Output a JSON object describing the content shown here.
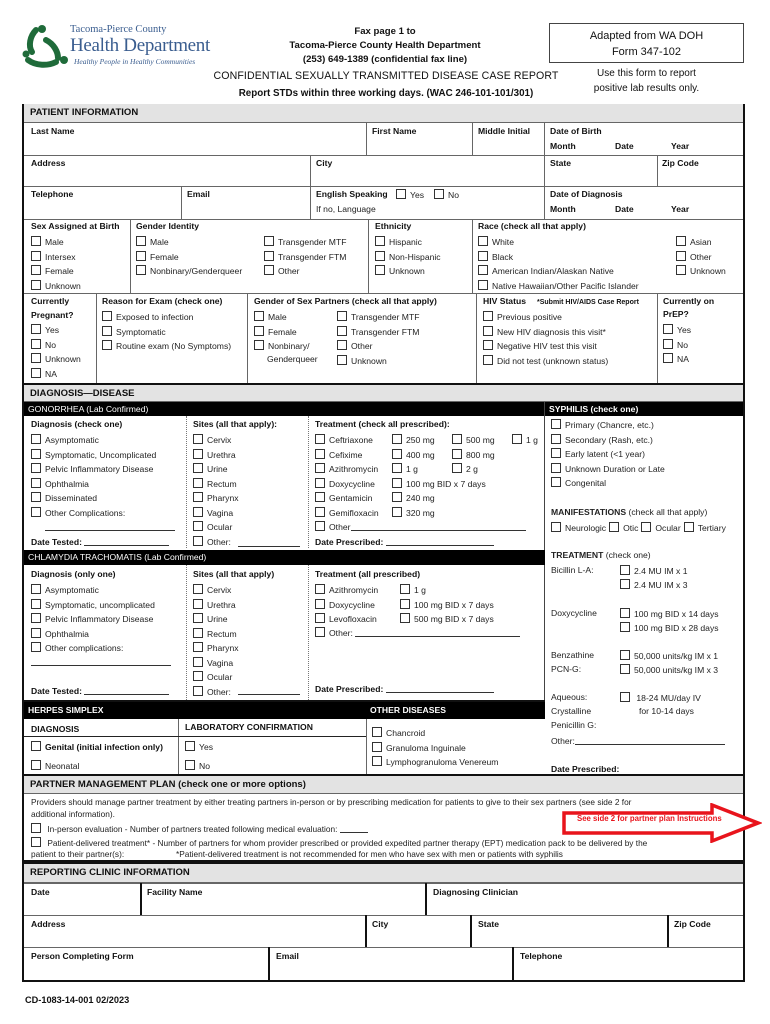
{
  "header": {
    "logo": {
      "org_top": "Tacoma-Pierce County",
      "org_main": "Health Department",
      "tagline": "Healthy People in Healthy Communities",
      "brand_color": "#1f6b3a",
      "text_color": "#3a5d8f"
    },
    "fax_line1": "Fax page 1 to",
    "fax_line2": "Tacoma-Pierce County Health Department",
    "fax_line3": "(253) 649-1389 (confidential fax line)",
    "title": "CONFIDENTIAL SEXUALLY TRANSMITTED DISEASE CASE REPORT",
    "subtitle": "Report STDs within three working days. (WAC 246-101-101/301)",
    "adapted_line1": "Adapted from WA DOH",
    "adapted_line2": "Form 347-102",
    "note_line1": "Use this form to report",
    "note_line2": "positive lab results only."
  },
  "patient": {
    "section_title": "PATIENT INFORMATION",
    "last_name": "Last Name",
    "first_name": "First Name",
    "middle_initial": "Middle Initial",
    "dob": "Date of Birth",
    "month": "Month",
    "date": "Date",
    "year": "Year",
    "address": "Address",
    "city": "City",
    "state": "State",
    "zip": "Zip Code",
    "telephone": "Telephone",
    "email": "Email",
    "english_speaking": "English Speaking",
    "yes": "Yes",
    "no": "No",
    "if_no_language": "If no, Language",
    "date_of_diagnosis": "Date of Diagnosis",
    "sex_at_birth": {
      "label": "Sex Assigned at Birth",
      "options": [
        "Male",
        "Intersex",
        "Female",
        "Unknown"
      ]
    },
    "gender_identity": {
      "label": "Gender Identity",
      "col1": [
        "Male",
        "Female",
        "Nonbinary/Genderqueer"
      ],
      "col2": [
        "Transgender MTF",
        "Transgender FTM",
        "Other"
      ]
    },
    "ethnicity": {
      "label": "Ethnicity",
      "options": [
        "Hispanic",
        "Non-Hispanic",
        "Unknown"
      ]
    },
    "race": {
      "label": "Race (check all that apply)",
      "col1": [
        "White",
        "Black",
        "American Indian/Alaskan Native",
        "Native Hawaiian/Other Pacific Islander"
      ],
      "col2": [
        "Asian",
        "Other",
        "Unknown"
      ]
    },
    "pregnant": {
      "label1": "Currently",
      "label2": "Pregnant?",
      "options": [
        "Yes",
        "No",
        "Unknown",
        "NA"
      ]
    },
    "reason": {
      "label": "Reason for Exam (check one)",
      "options": [
        "Exposed to infection",
        "Symptomatic",
        "Routine exam (No Symptoms)"
      ]
    },
    "partners_gender": {
      "label": "Gender of Sex Partners (check all that apply)",
      "col1": [
        "Male",
        "Female",
        "Nonbinary/"
      ],
      "col1_extra": "Genderqueer",
      "col2": [
        "Transgender MTF",
        "Transgender FTM",
        "Other",
        "Unknown"
      ]
    },
    "hiv": {
      "label": "HIV Status",
      "note": "*Submit HIV/AIDS Case Report",
      "options": [
        "Previous positive",
        "New HIV diagnosis this visit*",
        "Negative HIV test this visit",
        "Did not test (unknown status)"
      ]
    },
    "prep": {
      "label1": "Currently on",
      "label2": "PrEP?",
      "options": [
        "Yes",
        "No",
        "NA"
      ]
    }
  },
  "diagnosis": {
    "section_title": "DIAGNOSIS—DISEASE",
    "gonorrhea": {
      "title": "GONORRHEA (Lab Confirmed)",
      "dx_label": "Diagnosis (check one)",
      "dx_options": [
        "Asymptomatic",
        "Symptomatic, Uncomplicated",
        "Pelvic Inflammatory Disease",
        "Ophthalmia",
        "Disseminated",
        "Other Complications:"
      ],
      "date_tested": "Date Tested:",
      "sites_label": "Sites (all that apply):",
      "sites": [
        "Cervix",
        "Urethra",
        "Urine",
        "Rectum",
        "Pharynx",
        "Vagina",
        "Ocular",
        "Other:"
      ],
      "tx_label": "Treatment (check all prescribed):",
      "tx_rows": [
        {
          "drug": "Ceftriaxone",
          "doses": [
            "250 mg",
            "500 mg",
            "1 g"
          ]
        },
        {
          "drug": "Cefixime",
          "doses": [
            "400 mg",
            "800 mg"
          ]
        },
        {
          "drug": "Azithromycin",
          "doses": [
            "1 g",
            "2 g"
          ]
        },
        {
          "drug": "Doxycycline",
          "doses": [
            "100 mg BID x 7 days"
          ]
        },
        {
          "drug": "Gentamicin",
          "doses": [
            "240 mg"
          ]
        },
        {
          "drug": "Gemifloxacin",
          "doses": [
            "320 mg"
          ]
        }
      ],
      "tx_other": "Other",
      "date_prescribed": "Date Prescribed:"
    },
    "chlamydia": {
      "title": "CHLAMYDIA TRACHOMATIS (Lab Confirmed)",
      "dx_label": "Diagnosis (only one)",
      "dx_options": [
        "Asymptomatic",
        "Symptomatic, uncomplicated",
        "Pelvic Inflammatory Disease",
        "Ophthalmia",
        "Other complications:"
      ],
      "date_tested": "Date Tested:",
      "sites_label": "Sites (all that apply)",
      "sites": [
        "Cervix",
        "Urethra",
        "Urine",
        "Rectum",
        "Pharynx",
        "Vagina",
        "Ocular",
        "Other:"
      ],
      "tx_label": "Treatment (all prescribed)",
      "tx_rows": [
        {
          "drug": "Azithromycin",
          "doses": [
            "1 g"
          ]
        },
        {
          "drug": "Doxycycline",
          "doses": [
            "100 mg BID x 7 days"
          ]
        },
        {
          "drug": "Levofloxacin",
          "doses": [
            "500 mg BID x 7 days"
          ]
        }
      ],
      "tx_other": "Other:",
      "date_prescribed": "Date Prescribed:"
    },
    "syphilis": {
      "title": "SYPHILIS (check one)",
      "options": [
        "Primary (Chancre, etc.)",
        "Secondary (Rash, etc.)",
        "Early latent (<1 year)",
        "Unknown Duration or Late",
        "Congenital"
      ],
      "manifestations_label": "MANIFESTATIONS",
      "manifestations_note": "(check all that apply)",
      "manifestations": [
        "Neurologic",
        "Otic",
        "Ocular",
        "Tertiary"
      ],
      "treatment_label": "TREATMENT",
      "treatment_note": "(check one)",
      "bicillin": "Bicillin L-A:",
      "bicillin_doses": [
        "2.4 MU IM x 1",
        "2.4 MU IM x 3"
      ],
      "doxy": "Doxycycline",
      "doxy_doses": [
        "100 mg BID x 14 days",
        "100 mg BID x 28 days"
      ],
      "benz1": "Benzathine",
      "benz2": "PCN-G:",
      "benz_doses": [
        "50,000 units/kg IM x 1",
        "50,000 units/kg IM x 3"
      ],
      "aq1": "Aqueous:",
      "aq2": "Crystalline",
      "aq3": "Penicillin G:",
      "aq_dose1": "18-24 MU/day IV",
      "aq_dose2": "for 10-14 days",
      "other": "Other:",
      "date_prescribed": "Date Prescribed:"
    },
    "herpes": {
      "title": "HERPES SIMPLEX",
      "dx_label": "DIAGNOSIS",
      "lab_label": "LABORATORY CONFIRMATION",
      "genital": "Genital (initial infection only)",
      "neonatal": "Neonatal",
      "yes": "Yes",
      "no": "No"
    },
    "other_diseases": {
      "title": "OTHER DISEASES",
      "options": [
        "Chancroid",
        "Granuloma Inguinale",
        "Lymphogranuloma Venereum"
      ]
    }
  },
  "partner": {
    "section_title": "PARTNER MANAGEMENT PLAN (check one or more options)",
    "intro1": "Providers should manage partner treatment by either treating partners in-person or by prescribing medication for patients to give to their sex partners (see side 2 for",
    "intro2": "additional information).",
    "callout": "See side 2 for partner plan Instructions",
    "callout_color": "#e8141c",
    "opt1": "In-person evaluation - Number of partners treated following medical evaluation:",
    "opt2": "Patient-delivered treatment* - Number of partners for whom provider prescribed or provided expedited partner therapy (EPT) medication pack to be  delivered by the",
    "opt2b": "patient to their partner(s):",
    "opt2note": "*Patient-delivered treatment is not recommended for men who have sex with men or patients with syphilis"
  },
  "clinic": {
    "section_title": "REPORTING CLINIC INFORMATION",
    "date": "Date",
    "facility": "Facility Name",
    "clinician": "Diagnosing Clinician",
    "address": "Address",
    "city": "City",
    "state": "State",
    "zip": "Zip Code",
    "person": "Person Completing Form",
    "email": "Email",
    "telephone": "Telephone"
  },
  "footer": {
    "form_id": "CD-1083-14-001 02/2023"
  }
}
